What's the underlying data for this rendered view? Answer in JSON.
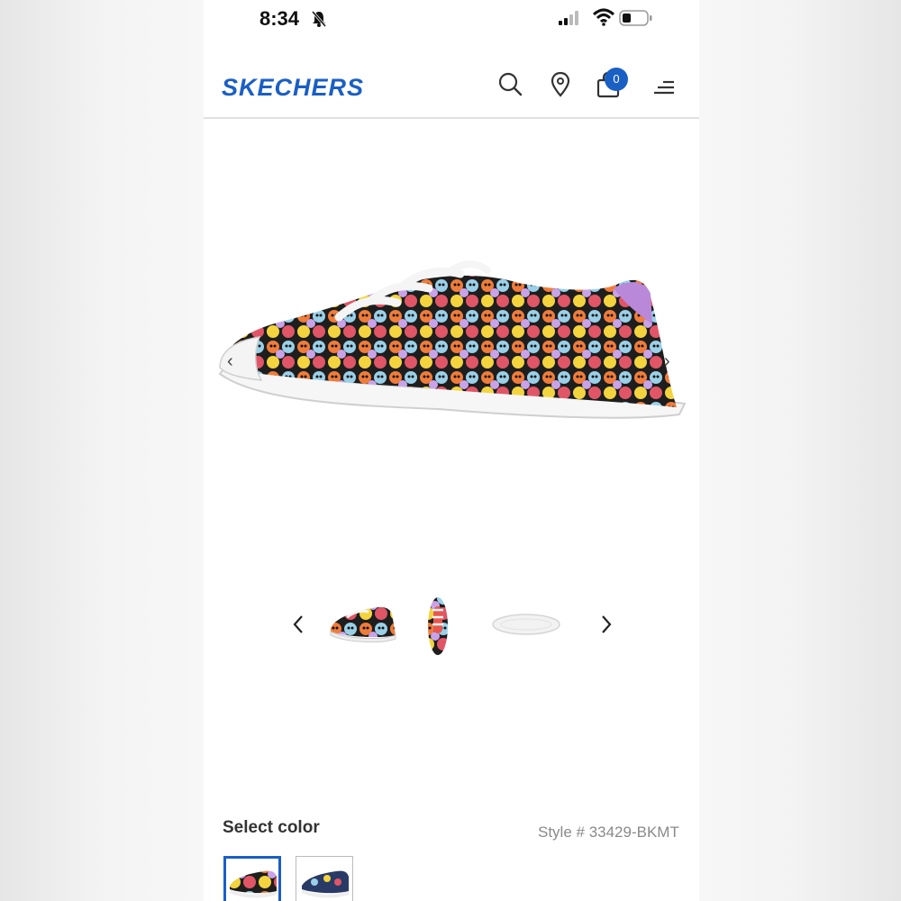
{
  "status_bar": {
    "time": "8:34"
  },
  "header": {
    "logo": "SKECHERS",
    "cart_count": "0"
  },
  "product": {
    "select_color_label": "Select color",
    "style_number": "Style # 33429-BKMT"
  },
  "colors": {
    "brand": "#1a5fc4"
  }
}
